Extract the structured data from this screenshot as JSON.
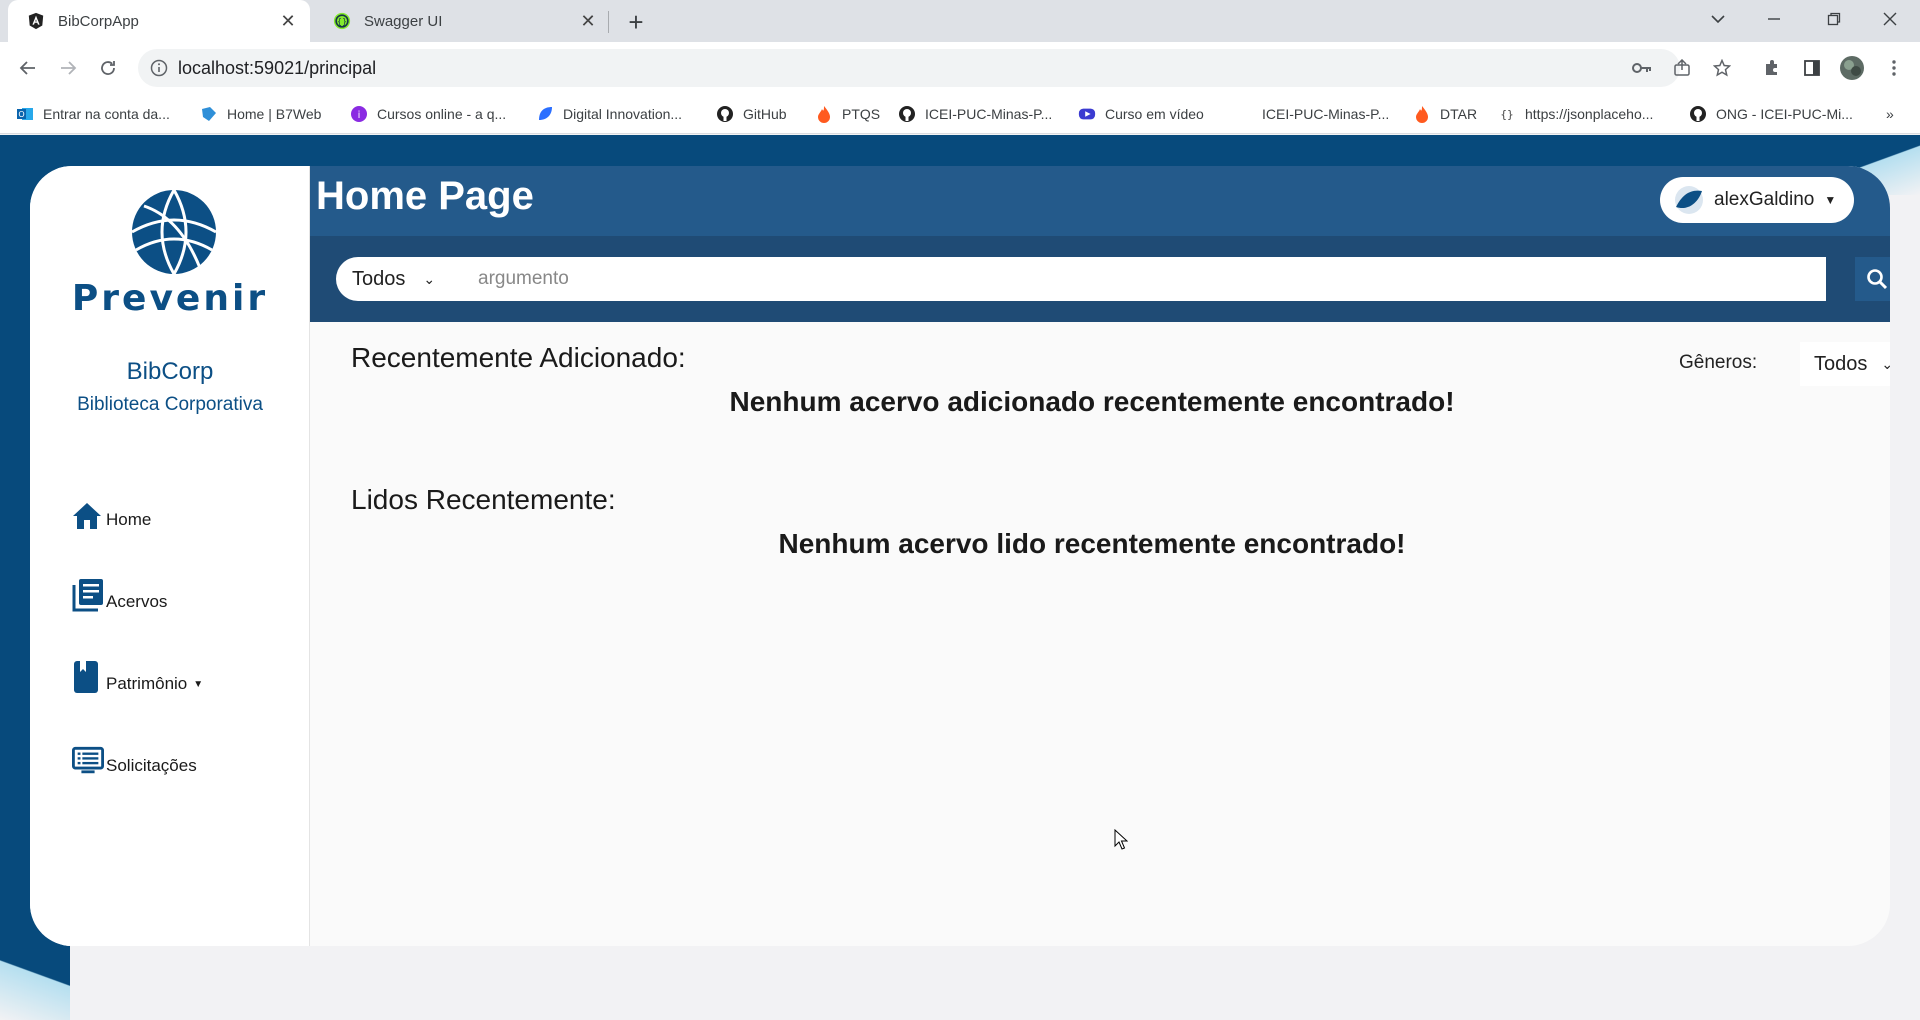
{
  "browser": {
    "tabs": [
      {
        "title": "BibCorpApp",
        "icon": "angular-icon",
        "active": true
      },
      {
        "title": "Swagger UI",
        "icon": "swagger-icon",
        "active": false
      }
    ],
    "url": "localhost:59021/principal",
    "bookmarks": [
      {
        "label": "Entrar na conta da...",
        "icon": "outlook-icon"
      },
      {
        "label": "Home | B7Web",
        "icon": "b7web-icon"
      },
      {
        "label": "Cursos online - a q...",
        "icon": "cursos-icon"
      },
      {
        "label": "Digital Innovation...",
        "icon": "dio-icon"
      },
      {
        "label": "GitHub",
        "icon": "github-icon"
      },
      {
        "label": "PTQS",
        "icon": "fire-icon"
      },
      {
        "label": "ICEI-PUC-Minas-P...",
        "icon": "github-icon"
      },
      {
        "label": "Curso em vídeo",
        "icon": "video-icon"
      },
      {
        "label": "ICEI-PUC-Minas-P...",
        "icon": "none"
      },
      {
        "label": "DTAR",
        "icon": "fire-icon"
      },
      {
        "label": "https://jsonplaceho...",
        "icon": "json-icon"
      },
      {
        "label": "ONG - ICEI-PUC-Mi...",
        "icon": "github-icon"
      }
    ],
    "more_bookmarks": "»"
  },
  "colors": {
    "brand": "#0c4f85",
    "header": "#245a8b",
    "search_band": "#1f4b75",
    "frame": "#074a7c"
  },
  "sidebar": {
    "logo_text": "Prevenir",
    "app_name": "BibCorp",
    "app_subtitle": "Biblioteca Corporativa",
    "items": [
      {
        "label": "Home",
        "icon": "home-icon"
      },
      {
        "label": "Acervos",
        "icon": "library-icon"
      },
      {
        "label": "Patrimônio",
        "icon": "book-icon",
        "dropdown": true
      },
      {
        "label": "Solicitações",
        "icon": "monitor-list-icon"
      }
    ]
  },
  "header": {
    "title": "Home Page",
    "user": "alexGaldino"
  },
  "search": {
    "filter_value": "Todos",
    "placeholder": "argumento",
    "value": ""
  },
  "main": {
    "recent_added_title": "Recentemente Adicionado:",
    "recent_added_empty": "Nenhum acervo adicionado recentemente encontrado!",
    "recent_read_title": "Lidos Recentemente:",
    "recent_read_empty": "Nenhum acervo lido recentemente encontrado!",
    "genres_label": "Gêneros:",
    "genres_value": "Todos"
  }
}
